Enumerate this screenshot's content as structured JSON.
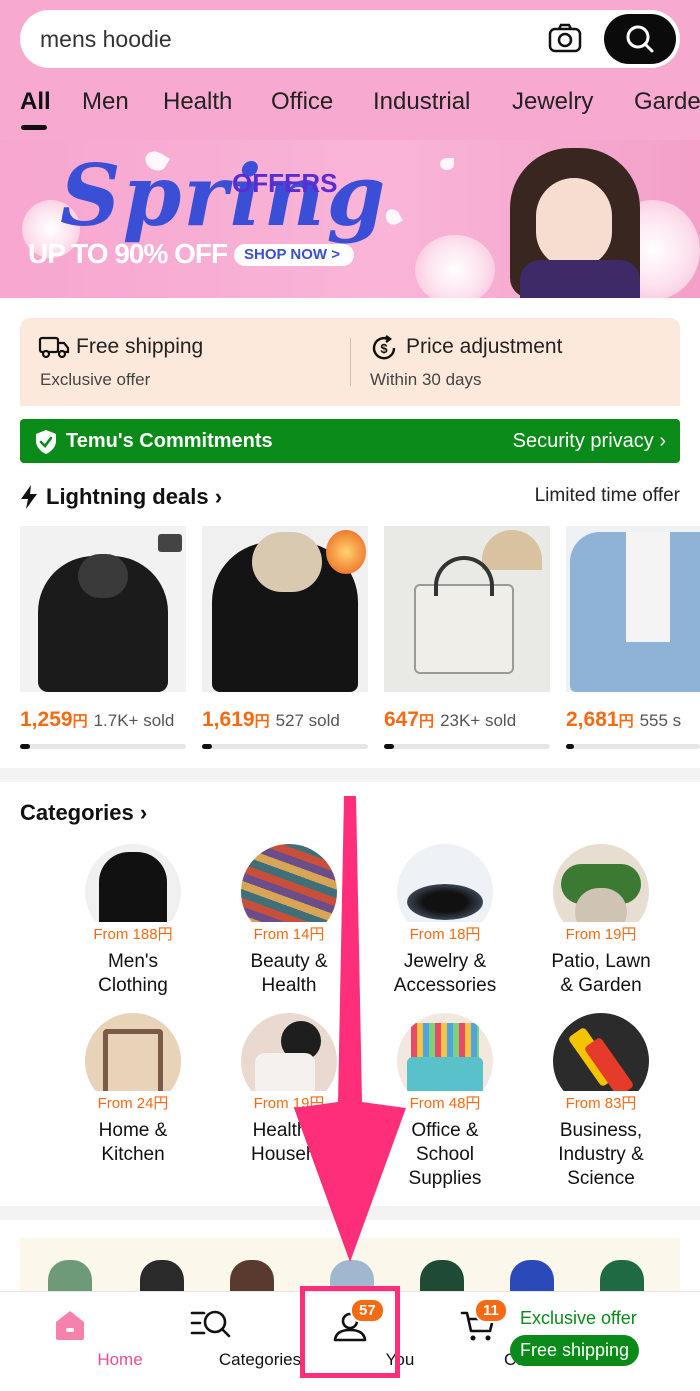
{
  "search": {
    "value": "mens hoodie"
  },
  "tabs": [
    {
      "label": "All"
    },
    {
      "label": "Men"
    },
    {
      "label": "Health"
    },
    {
      "label": "Office"
    },
    {
      "label": "Industrial"
    },
    {
      "label": "Jewelry"
    },
    {
      "label": "Garde"
    }
  ],
  "banner": {
    "headline": "Spring",
    "offers": "OFFERS",
    "discount": "UP TO 90% OFF",
    "cta": "SHOP NOW >"
  },
  "info": {
    "shipping_title": "Free shipping",
    "shipping_sub": "Exclusive offer",
    "price_title": "Price adjustment",
    "price_sub": "Within 30 days"
  },
  "commitments": {
    "title": "Temu's Commitments",
    "right": "Security privacy"
  },
  "deals": {
    "title": "Lightning deals",
    "right": "Limited time offer",
    "products": [
      {
        "price": "1,259",
        "currency": "円",
        "sold": "1.7K+ sold",
        "progress": 0.06
      },
      {
        "price": "1,619",
        "currency": "円",
        "sold": "527 sold",
        "progress": 0.06
      },
      {
        "price": "647",
        "currency": "円",
        "sold": "23K+ sold",
        "progress": 0.06
      },
      {
        "price": "2,681",
        "currency": "円",
        "sold": "555 s",
        "progress": 0.06
      }
    ]
  },
  "categories": {
    "title": "Categories",
    "items": [
      {
        "price": "From 188円",
        "name_1": "Men's",
        "name_2": "Clothing",
        "name_3": ""
      },
      {
        "price": "From 14円",
        "name_1": "Beauty &",
        "name_2": "Health",
        "name_3": ""
      },
      {
        "price": "From 18円",
        "name_1": "Jewelry &",
        "name_2": "Accessories",
        "name_3": ""
      },
      {
        "price": "From 19円",
        "name_1": "Patio, Lawn",
        "name_2": "& Garden",
        "name_3": ""
      },
      {
        "price": "From 24円",
        "name_1": "Home &",
        "name_2": "Kitchen",
        "name_3": ""
      },
      {
        "price": "From 19円",
        "name_1": "Health &",
        "name_2": "Househo",
        "name_3": ""
      },
      {
        "price": "From 48円",
        "name_1": "Office &",
        "name_2": "School",
        "name_3": "Supplies"
      },
      {
        "price": "From 83円",
        "name_1": "Business,",
        "name_2": "Industry &",
        "name_3": "Science"
      }
    ]
  },
  "nav": {
    "home": "Home",
    "categories": "Categories",
    "you": "You",
    "you_badge": "57",
    "cart": "Cart",
    "cart_badge": "11",
    "exclusive": "Exclusive offer",
    "free_shipping": "Free shipping"
  },
  "colors": {
    "header_bg": "#f8a9d0",
    "accent_orange": "#f56a12",
    "commit_green": "#0a8a18",
    "highlight_pink": "#ff2e7a"
  }
}
